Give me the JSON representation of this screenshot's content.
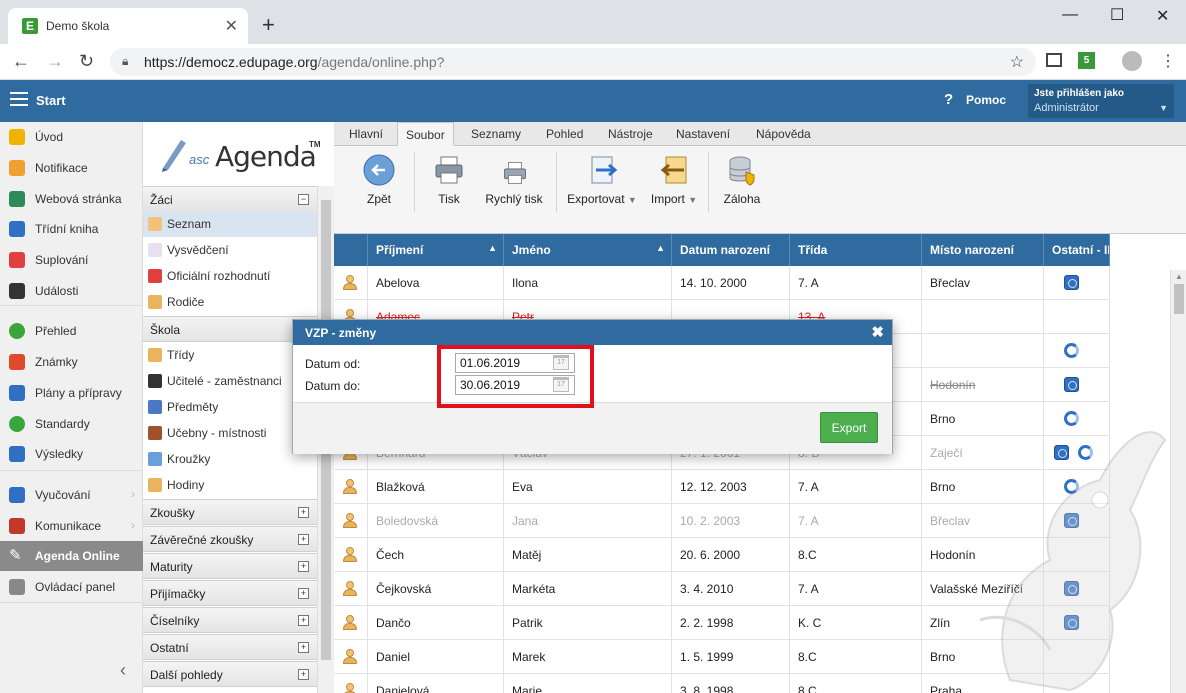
{
  "browser": {
    "tab_title": "Demo škola",
    "tab_favicon_letter": "E",
    "url_host": "https://democz.edupage.org",
    "url_path": "/agenda/online.php?",
    "ext_badge": "5"
  },
  "header": {
    "start_label": "Start",
    "help_label": "Pomoc",
    "login_line1": "Jste přihlášen jako",
    "login_line2": "Administrátor"
  },
  "leftnav": {
    "items": [
      {
        "label": "Úvod",
        "icon": "star-icon",
        "color": "#f0b400"
      },
      {
        "label": "Notifikace",
        "icon": "envelope-icon",
        "color": "#f0a030"
      },
      {
        "label": "Webová stránka",
        "icon": "house-icon",
        "color": "#2e8b57"
      },
      {
        "label": "Třídní kniha",
        "icon": "book-icon",
        "color": "#2f6fc4"
      },
      {
        "label": "Suplování",
        "icon": "person-icon",
        "color": "#e04040"
      },
      {
        "label": "Události",
        "icon": "calendar-icon",
        "color": "#333333"
      },
      {
        "label": "Přehled",
        "icon": "check-icon",
        "color": "#3aa53a"
      },
      {
        "label": "Známky",
        "icon": "grades-icon",
        "color": "#e04a2a"
      },
      {
        "label": "Plány a přípravy",
        "icon": "briefcase-icon",
        "color": "#2f6fc4"
      },
      {
        "label": "Standardy",
        "icon": "shield-icon",
        "color": "#3aa53a"
      },
      {
        "label": "Výsledky",
        "icon": "bar-chart-icon",
        "color": "#2f6fc4"
      },
      {
        "label": "Vyučování",
        "icon": "open-book-icon",
        "color": "#2f6fc4"
      },
      {
        "label": "Komunikace",
        "icon": "chat-icon",
        "color": "#c0392b"
      },
      {
        "label": "Agenda Online",
        "icon": "pen-icon",
        "color": "#ffffff"
      },
      {
        "label": "Ovládací panel",
        "icon": "gear-icon",
        "color": "#888888"
      }
    ]
  },
  "logo": {
    "prefix": "asc",
    "name": "Agenda",
    "tm": "TM"
  },
  "tree": {
    "sections": [
      {
        "label": "Žáci",
        "toggle": "−"
      },
      {
        "label": "Škola",
        "toggle": "−"
      },
      {
        "label": "Zkoušky",
        "toggle": "+"
      },
      {
        "label": "Závěrečné zkoušky",
        "toggle": "+"
      },
      {
        "label": "Maturity",
        "toggle": "+"
      },
      {
        "label": "Přijímačky",
        "toggle": "+"
      },
      {
        "label": "Číselníky",
        "toggle": "+"
      },
      {
        "label": "Ostatní",
        "toggle": "+"
      },
      {
        "label": "Další pohledy",
        "toggle": "+"
      }
    ],
    "zaci_items": [
      "Seznam",
      "Vysvědčení",
      "Oficiální rozhodnutí",
      "Rodiče"
    ],
    "skola_items": [
      "Třídy",
      "Učitelé - zaměstnanci",
      "Předměty",
      "Učebny - místnosti",
      "Kroužky",
      "Hodiny"
    ]
  },
  "ribbon": {
    "tabs": [
      "Hlavní",
      "Soubor",
      "Seznamy",
      "Pohled",
      "Nástroje",
      "Nastavení",
      "Nápověda"
    ],
    "buttons": {
      "back": "Zpět",
      "print": "Tisk",
      "quick_print": "Rychlý tisk",
      "export": "Exportovat",
      "import": "Import",
      "backup": "Záloha"
    }
  },
  "grid": {
    "columns": [
      "Příjmení",
      "Jméno",
      "Datum narození",
      "Třída",
      "Místo narození",
      "Ostatní - II"
    ],
    "rows": [
      {
        "prijmeni": "Abelova",
        "jmeno": "Ilona",
        "datum": "14. 10. 2000",
        "trida": "7. A",
        "misto": "Břeclav",
        "icons": [
          "sq"
        ],
        "style": ""
      },
      {
        "prijmeni": "Adamec",
        "jmeno": "Petr",
        "datum": "",
        "trida": "13. A",
        "misto": "",
        "icons": [],
        "style": "strike"
      },
      {
        "prijmeni": "",
        "jmeno": "",
        "datum": "",
        "trida": "",
        "misto": "",
        "icons": [
          "cy"
        ],
        "style": ""
      },
      {
        "prijmeni": "",
        "jmeno": "",
        "datum": "",
        "trida": "",
        "misto": "Hodonín",
        "icons": [
          "sq"
        ],
        "style": "dimstrike"
      },
      {
        "prijmeni": "",
        "jmeno": "",
        "datum": "",
        "trida": "",
        "misto": "Brno",
        "icons": [
          "cy"
        ],
        "style": ""
      },
      {
        "prijmeni": "Bernhard",
        "jmeno": "Václav",
        "datum": "27. 1. 2001",
        "trida": "8. B",
        "misto": "Zaječí",
        "icons": [
          "sq",
          "cy"
        ],
        "style": "dim"
      },
      {
        "prijmeni": "Blažková",
        "jmeno": "Eva",
        "datum": "12. 12. 2003",
        "trida": "7. A",
        "misto": "Brno",
        "icons": [
          "cy"
        ],
        "style": ""
      },
      {
        "prijmeni": "Boledovská",
        "jmeno": "Jana",
        "datum": "10. 2. 2003",
        "trida": "7. A",
        "misto": "Břeclav",
        "icons": [
          "sq"
        ],
        "style": "dim"
      },
      {
        "prijmeni": "Čech",
        "jmeno": "Matěj",
        "datum": "20. 6. 2000",
        "trida": "8.C",
        "misto": "Hodonín",
        "icons": [],
        "style": ""
      },
      {
        "prijmeni": "Čejkovská",
        "jmeno": "Markéta",
        "datum": "3. 4. 2010",
        "trida": "7. A",
        "misto": "Valašské Meziříčí",
        "icons": [
          "sq"
        ],
        "style": ""
      },
      {
        "prijmeni": "Dančo",
        "jmeno": "Patrik",
        "datum": "2. 2. 1998",
        "trida": "K. C",
        "misto": "Zlín",
        "icons": [
          "sq"
        ],
        "style": ""
      },
      {
        "prijmeni": "Daniel",
        "jmeno": "Marek",
        "datum": "1. 5. 1999",
        "trida": "8.C",
        "misto": "Brno",
        "icons": [],
        "style": ""
      },
      {
        "prijmeni": "Danielová",
        "jmeno": "Marie",
        "datum": "3. 8. 1998",
        "trida": "8.C",
        "misto": "Praha",
        "icons": [],
        "style": ""
      }
    ]
  },
  "dialog": {
    "title": "VZP - změny",
    "close": "✖",
    "from_label": "Datum od:",
    "from_value": "01.06.2019",
    "to_label": "Datum do:",
    "to_value": "30.06.2019",
    "export_label": "Export",
    "cal_label": "17"
  },
  "colors": {
    "header_blue": "#2f6b9e",
    "export_green": "#4cae4c",
    "highlight_red": "#e0101c"
  }
}
